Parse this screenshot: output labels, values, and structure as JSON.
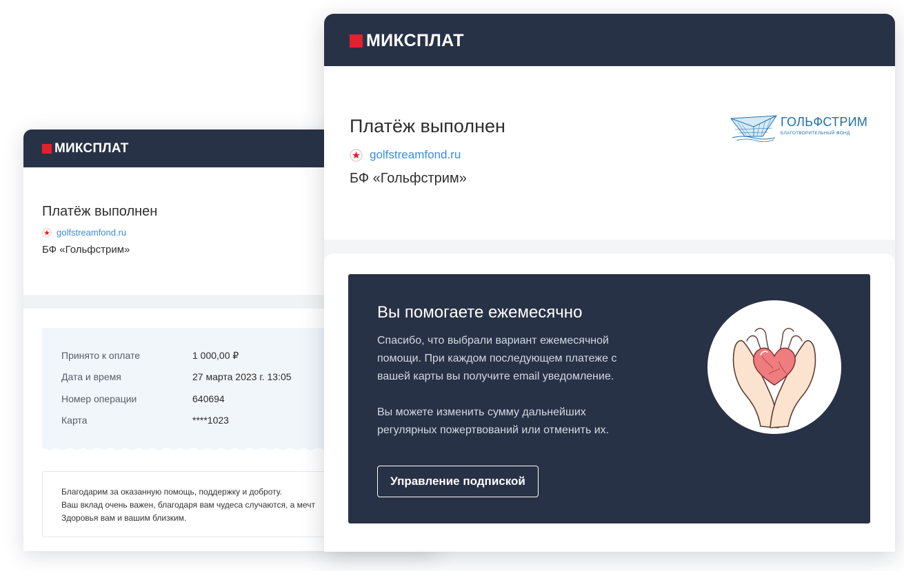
{
  "back_card": {
    "brand": "МИКСПЛАТ",
    "title": "Платёж выполнен",
    "site": "golfstreamfond.ru",
    "org": "БФ «Гольфстрим»",
    "receipt": [
      {
        "label": "Принято к оплате",
        "value": "1 000,00 ₽"
      },
      {
        "label": "Дата и время",
        "value": "27 марта 2023 г. 13:05"
      },
      {
        "label": "Номер операции",
        "value": "640694"
      },
      {
        "label": "Карта",
        "value": "****1023"
      }
    ],
    "thanks": [
      "Благодарим за оказанную помощь, поддержку и доброту.",
      "Ваш вклад очень важен, благодаря вам чудеса случаются, а мечт",
      "Здоровья вам и вашим близким."
    ]
  },
  "front_card": {
    "brand": "МИКСПЛАТ",
    "title": "Платёж выполнен",
    "site": "golfstreamfond.ru",
    "org": "БФ «Гольфстрим»",
    "logo": {
      "name": "ГОЛЬФСТРИМ",
      "subtitle": "БЛАГОТВОРИТЕЛЬНЫЙ ФОНД"
    },
    "promo": {
      "title": "Вы помогаете ежемесячно",
      "lines": [
        "Спасибо, что выбрали вариант ежемесячной",
        "помощи. При каждом последующем платеже с",
        "вашей карты вы получите email уведомление.",
        "Вы можете изменить сумму дальнейших",
        "регулярных пожертвований или отменить их."
      ],
      "button": "Управление подпиской"
    }
  },
  "colors": {
    "header_bg": "#283246",
    "brand_red": "#e3212e",
    "link": "#3a8ed6",
    "receipt_bg": "#f1f6fb",
    "logo_blue": "#1e6fa8"
  },
  "icons": {
    "brand": "red-square-logo-icon",
    "site": "red-star-icon",
    "foundation": "paper-boat-logo-icon",
    "promo": "hands-holding-heart-icon"
  }
}
